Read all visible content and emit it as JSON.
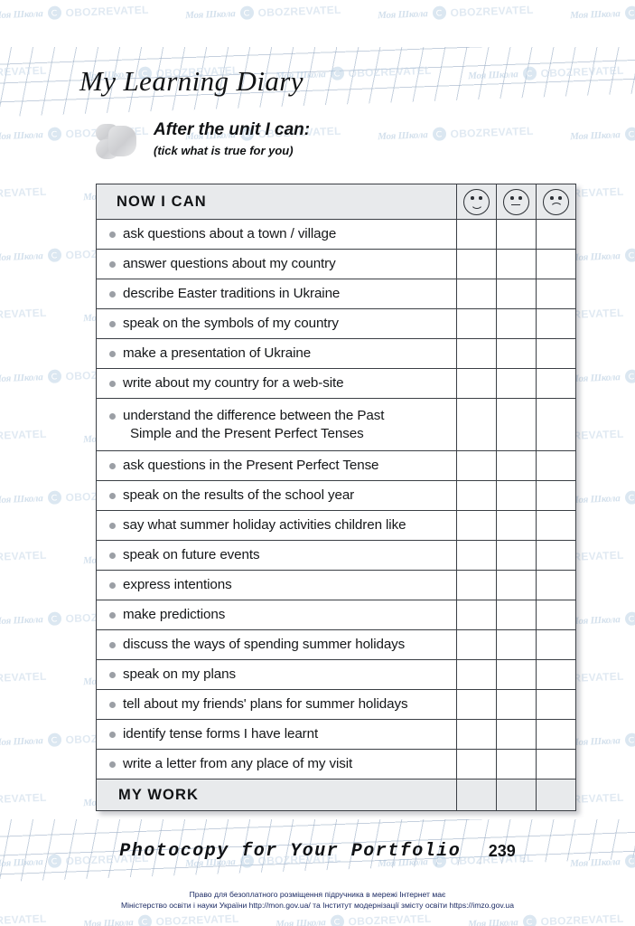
{
  "page": {
    "title": "My Learning Diary",
    "page_number": "239",
    "footer_note": "Photocopy for Your Portfolio"
  },
  "intro": {
    "heading": "After the unit I can:",
    "subheading": "(tick what is true for you)",
    "icon": "puzzle-piece-icon"
  },
  "table": {
    "header_label": "NOW  I  CAN",
    "rating_columns": [
      {
        "name": "happy-face-icon",
        "mood": "happy"
      },
      {
        "name": "neutral-face-icon",
        "mood": "neutral"
      },
      {
        "name": "sad-face-icon",
        "mood": "sad"
      }
    ],
    "rows": [
      {
        "label": "ask questions about a town / village",
        "line2": ""
      },
      {
        "label": "answer questions about my country",
        "line2": ""
      },
      {
        "label": "describe Easter traditions in Ukraine",
        "line2": ""
      },
      {
        "label": "speak on the symbols of my country",
        "line2": ""
      },
      {
        "label": "make a presentation of Ukraine",
        "line2": ""
      },
      {
        "label": "write about my country for a web-site",
        "line2": ""
      },
      {
        "label": "understand the difference between the Past",
        "line2": "Simple and the Present Perfect Tenses"
      },
      {
        "label": "ask questions in the Present Perfect Tense",
        "line2": ""
      },
      {
        "label": "speak on the results of the school year",
        "line2": ""
      },
      {
        "label": "say what summer holiday activities children like",
        "line2": ""
      },
      {
        "label": "speak on future events",
        "line2": ""
      },
      {
        "label": "express intentions",
        "line2": ""
      },
      {
        "label": "make predictions",
        "line2": ""
      },
      {
        "label": "discuss the ways of spending summer holidays",
        "line2": ""
      },
      {
        "label": "speak on my plans",
        "line2": ""
      },
      {
        "label": "tell about my friends' plans for summer holidays",
        "line2": ""
      },
      {
        "label": "identify tense forms I have learnt",
        "line2": ""
      },
      {
        "label": "write a letter from any place of my visit",
        "line2": ""
      }
    ],
    "footer_label": "MY  WORK"
  },
  "legal": {
    "line1": "Право для безоплатного розміщення підручника в мережі Інтернет має",
    "line2": "Міністерство освіти і науки України http://mon.gov.ua/ та Інститут модернізації змісту освіти https://imzo.gov.ua"
  },
  "watermark": {
    "school_text": "Моя Школа",
    "brand_text": "OBOZREVATEL"
  },
  "colors": {
    "header_fill": "#e8eaec",
    "border": "#3b3f45",
    "bullet": "#9b9fa5",
    "legal_text": "#1b2a63",
    "watermark_blue": "#c2d5e6"
  }
}
